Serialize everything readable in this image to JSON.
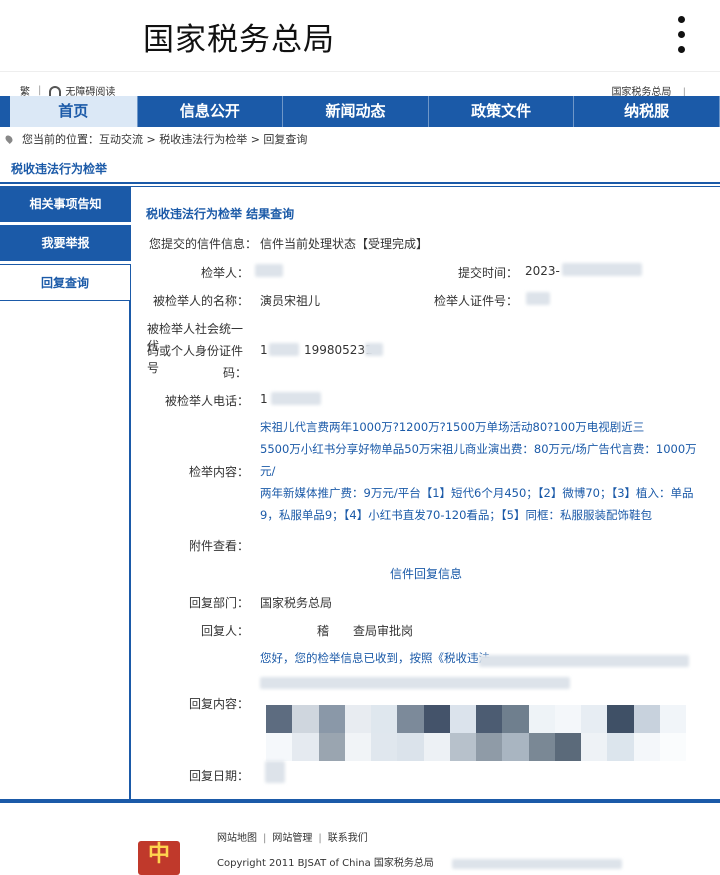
{
  "browser": {
    "title": "国家税务总局",
    "menu_icon": "more-vertical-icon"
  },
  "util": {
    "traditional": "繁",
    "accessibility": "无障碍阅读",
    "site_name": "国家税务总局"
  },
  "nav": {
    "items": [
      "首页",
      "信息公开",
      "新闻动态",
      "政策文件",
      "纳税服"
    ]
  },
  "breadcrumb": "您当前的位置：互动交流 > 税收违法行为检举 > 回复查询",
  "section_title": "税收违法行为检举",
  "sidebar": {
    "items": [
      "相关事项告知",
      "我要举报",
      "回复查询"
    ]
  },
  "content": {
    "title": "税收违法行为检举 结果查询",
    "letter_info_label": "您提交的信件信息：",
    "letter_info_value": "信件当前处理状态【受理完成】",
    "reporter_label": "检举人：",
    "submit_time_label": "提交时间：",
    "submit_time_value": "2023-",
    "accused_name_label": "被检举人的名称：",
    "accused_name_value": "演员宋祖儿",
    "reporter_id_label": "检举人证件号：",
    "accused_code_label_1": "被检举人社会统一代",
    "accused_code_label_2": "码或个人身份证件号",
    "accused_code_label_3": "码：",
    "accused_code_prefix": "1",
    "accused_code_value": "199805231",
    "accused_phone_label": "被检举人电话：",
    "accused_phone_value": "1",
    "report_content_label": "检举内容：",
    "report_lines": [
      "宋祖儿代言费两年1000万?1200万?1500万单场活动80?100万电视剧近三",
      "5500万小红书分享好物单品50万宋祖儿商业演出费：80万元/场广告代言费：1000万元/",
      "两年新媒体推广费：9万元/平台【1】短代6个月450；【2】微博70；【3】植入：单品",
      "9，私服单品9；【4】小红书直发70-120看品；【5】同框：私服服装配饰鞋包"
    ],
    "attachment_label": "附件查看：",
    "reply_header": "信件回复信息",
    "reply_dept_label": "回复部门：",
    "reply_dept_value": "国家税务总局",
    "replier_label": "回复人：",
    "replier_value_a": "稽",
    "replier_value_b": "查局审批岗",
    "reply_content_label": "回复内容：",
    "reply_content_line1": "您好，您的检举信息已收到，按照《税收违法",
    "reply_date_label": "回复日期："
  },
  "footer": {
    "links": [
      "网站地图",
      "网站管理",
      "联系我们"
    ],
    "copyright": "Copyright 2011 BJSAT of China 国家税务总局",
    "emblem": "emblem-icon"
  },
  "colors": {
    "brand_blue": "#1b5aa8",
    "nav_active_bg": "#dbe8f6"
  }
}
